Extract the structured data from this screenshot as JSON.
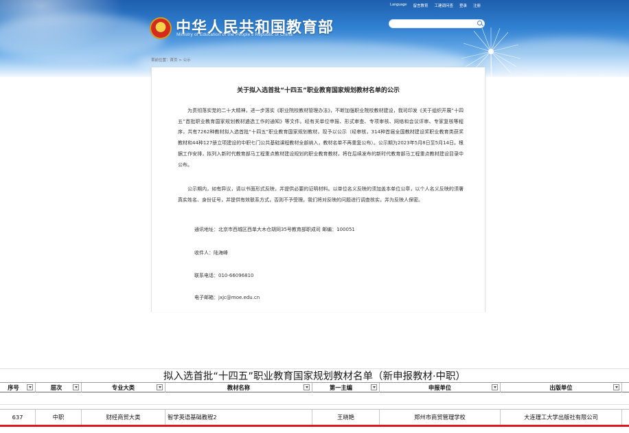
{
  "header": {
    "site_title": "中华人民共和国教育部",
    "site_subtitle": "Ministry of Education of the People's Republic of China",
    "top_links": [
      "Language",
      "留言教育",
      "工建调问查",
      "登录",
      "注册"
    ],
    "search_placeholder": "",
    "breadcrumb": "首前位置：首页 > 公示",
    "colors": {
      "banner_top": "#1f5fae",
      "banner_bottom": "#cfe6fb",
      "emblem_red": "#d42a1e",
      "emblem_gold": "#f7d24a"
    }
  },
  "notice": {
    "title": "关于拟入选首批“十四五”职业教育国家规划教材名单的公示",
    "paragraphs": [
      "为贯彻落实党的二十大精神，进一步落实《职业院校教材管理办法》，不断加强职业院校教材建设，我司印发《关于组织开展“十四五”首批职业教育国家规划教材遴选工作的通知》等文件。经有关单位申报、形式审查、专项审核、网络和会议评审、专家复核等程序，共有7262种教材拟入选首批“十四五”职业教育国家规划教材，现予以公示（经审核，314种首届全国教材建设奖职业教育类获奖教材和44种127册立项建设的中职七门公共基础课程教材全部纳入，教材名单不再重复公布）。公示期为2023年5月8日至5月14日。根据工作安排，拟列入新时代教育部马工程重点教材建设规划的职业教育教材，将在后续发布的新时代教育部马工程重点教材建设目录中公布。",
      "公示期内，如有异议，请以书面形式反映，并提供必要的证明材料。以单位名义反映的须加盖本单位公章，以个人名义反映的须署真实姓名、身份证号，并提供有效联系方式，否则不予受理。我们将对反映的问题进行调查核实，并为反映人保密。"
    ],
    "contact": {
      "address": "通讯地址：北京市西城区西单大木仓胡同35号教育部职成司   邮编：100051",
      "recipient": "收件人：陆海峰",
      "phone": "联系电话：010-66096810",
      "email": "电子邮箱：jxjc@moe.edu.cn"
    }
  },
  "sheet": {
    "title": "拟入选首批“十四五”职业教育国家规划教材名单（新申报教材·中职）",
    "columns": [
      "序号",
      "层次",
      "专业大类",
      "教材名称",
      "第一主编",
      "申报单位",
      "出版单位"
    ],
    "row": [
      "637",
      "中职",
      "财经商贸大类",
      "智学英语基础教程2",
      "王晓艳",
      "郑州市商贸管理学校",
      "大连理工大学出版社有限公司"
    ],
    "highlight_color": "#e0161d"
  }
}
